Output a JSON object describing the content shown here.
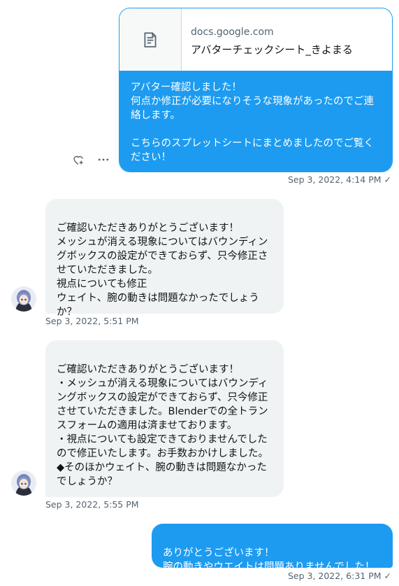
{
  "link_card": {
    "domain": "docs.google.com",
    "title": "アバターチェックシート_きよまる",
    "message": "アバター確認しました！\n何点か修正が必要になりそうな現象があったのでご連絡します。\n\nこちらのスプレットシートにまとめましたのでご覧ください！",
    "icon": "document-icon"
  },
  "messages": [
    {
      "direction": "outgoing",
      "timestamp": "Sep 3, 2022, 4:14 PM",
      "status": "✓"
    },
    {
      "direction": "incoming",
      "text": "ご確認いただきありがとうございます！\nメッシュが消える現象についてはバウンディングボックスの設定ができておらず、只今修正させていただきました。\n視点についても修正\nウェイト、腕の動きは問題なかったでしょうか？",
      "timestamp": "Sep 3, 2022, 5:51 PM"
    },
    {
      "direction": "incoming",
      "text": "ご確認いただきありがとうございます！\n・メッシュが消える現象についてはバウンディングボックスの設定ができておらず、只今修正させていただきました。Blenderでの全トランスフォームの適用は済ませております。\n・視点についても設定できておりませんでしたので修正いたします。お手数おかけしました。\n◆そのほかウェイト、腕の動きは問題なかったでしょうか？",
      "timestamp": "Sep 3, 2022, 5:55 PM"
    },
    {
      "direction": "outgoing",
      "text": "ありがとうございます！\n腕の動きやウエイトは問題ありませんでした！",
      "timestamp": "Sep 3, 2022, 6:31 PM",
      "status": "✓"
    }
  ],
  "colors": {
    "accent": "#1d9bf0",
    "incoming_bubble": "#eff3f4",
    "secondary_text": "#536471"
  }
}
